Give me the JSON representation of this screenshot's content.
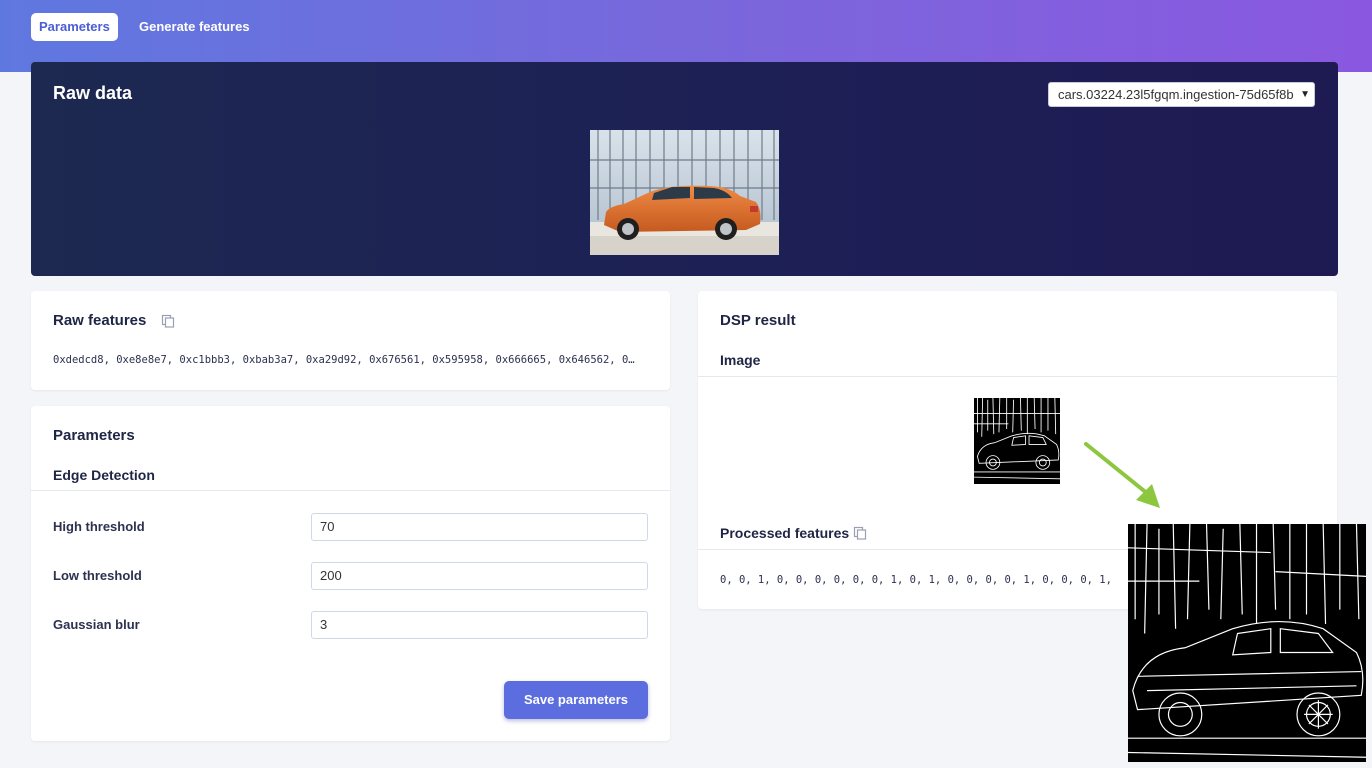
{
  "tabs": [
    {
      "label": "Parameters",
      "active": true
    },
    {
      "label": "Generate features",
      "active": false
    }
  ],
  "raw_data": {
    "title": "Raw data",
    "selected_sample": "cars.03224.23l5fgqm.ingestion-75d65f8b"
  },
  "raw_features": {
    "title": "Raw features",
    "values": "0xdedcd8, 0xe8e8e7, 0xc1bbb3, 0xbab3a7, 0xa29d92, 0x676561, 0x595958, 0x666665, 0x646562, 0…"
  },
  "parameters": {
    "title": "Parameters",
    "section": "Edge Detection",
    "fields": [
      {
        "label": "High threshold",
        "value": "70"
      },
      {
        "label": "Low threshold",
        "value": "200"
      },
      {
        "label": "Gaussian blur",
        "value": "3"
      }
    ],
    "save_label": "Save parameters"
  },
  "dsp_result": {
    "title": "DSP result",
    "image_label": "Image",
    "processed_title": "Processed features",
    "processed_values": "0, 0, 1, 0, 0, 0, 0, 0, 0, 1, 0, 1, 0, 0, 0, 0, 1, 0, 0, 0, 1,"
  },
  "colors": {
    "accent": "#5b6ddf",
    "header_start": "#5f78e0",
    "header_end": "#8a58e0",
    "panel_dark": "#1d2951",
    "arrow": "#8dc63f"
  },
  "icons": {
    "copy": "copy-icon",
    "dropdown": "chevron-down-icon"
  }
}
